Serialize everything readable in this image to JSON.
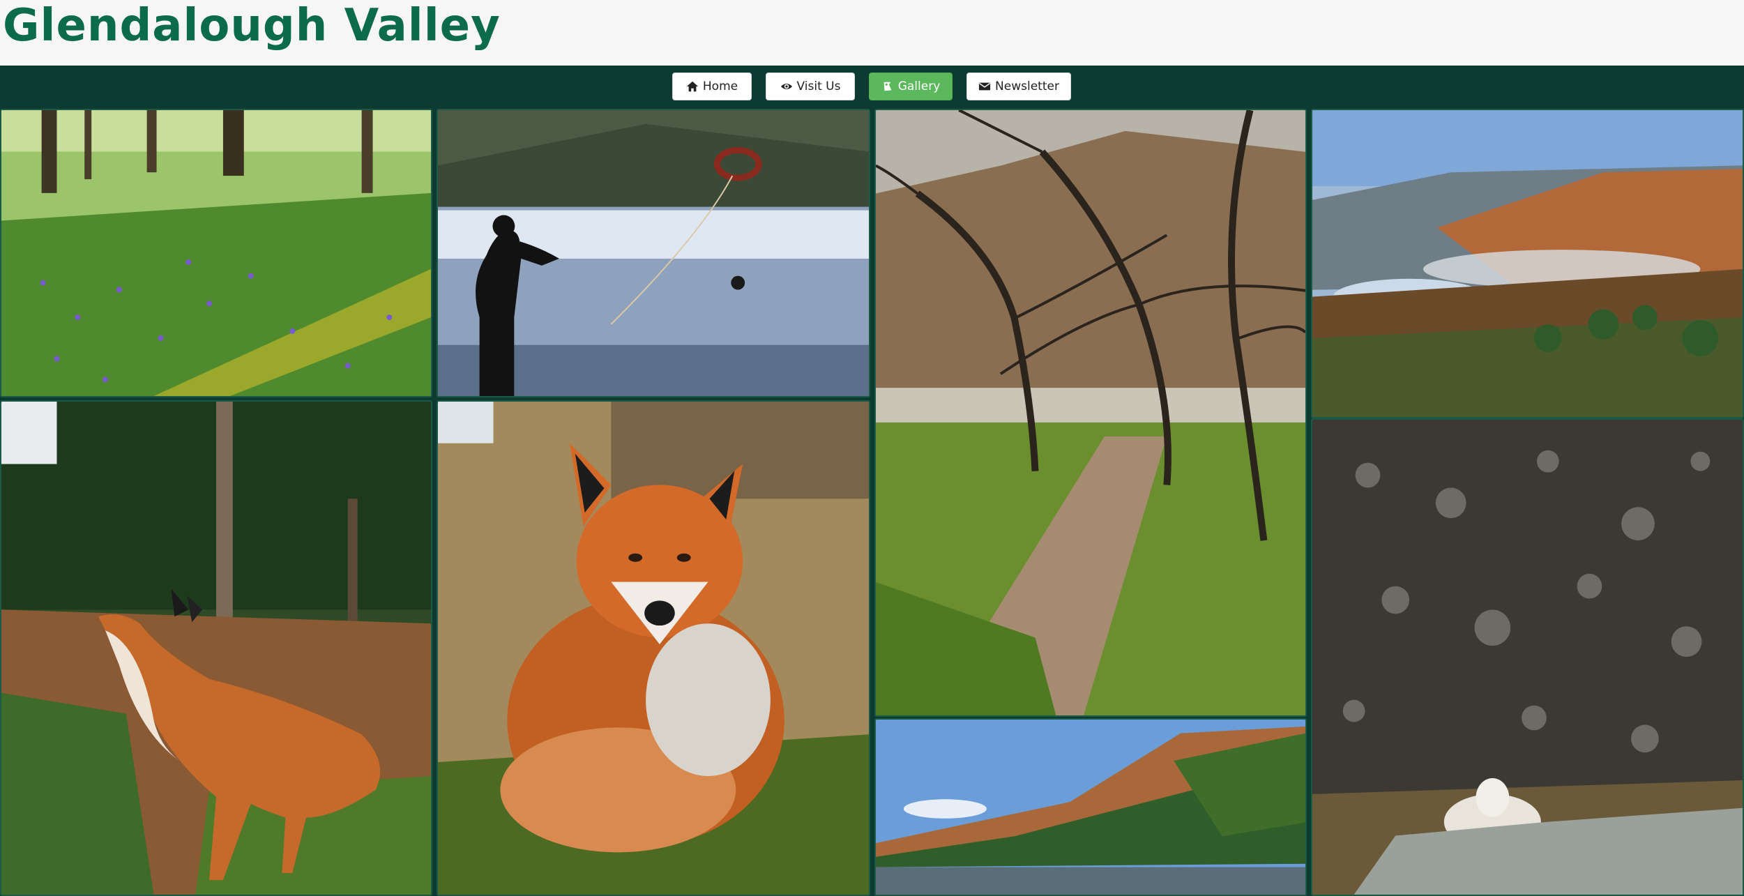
{
  "site": {
    "title": "Glendalough Valley"
  },
  "nav": [
    {
      "label": "Home",
      "icon": "home-icon",
      "active": false
    },
    {
      "label": "Visit Us",
      "icon": "eye-icon",
      "active": false
    },
    {
      "label": "Gallery",
      "icon": "image-icon",
      "active": true
    },
    {
      "label": "Newsletter",
      "icon": "envelope-icon",
      "active": false
    }
  ],
  "colors": {
    "header_bg": "#f6f6f6",
    "title": "#0c6b4a",
    "nav_bg": "#0d3b31",
    "active_button": "#5cb85c"
  },
  "gallery": [
    {
      "subject": "bluebell-woodland-photo"
    },
    {
      "subject": "lake-rescue-swimmer-photo"
    },
    {
      "subject": "bare-trees-lakeside-path-photo"
    },
    {
      "subject": "misty-valley-lake-photo"
    },
    {
      "subject": "fox-in-forest-photo"
    },
    {
      "subject": "fox-in-grass-closeup-photo"
    },
    {
      "subject": "mountain-lake-autumn-photo"
    },
    {
      "subject": "sheep-on-rock-photo"
    }
  ]
}
